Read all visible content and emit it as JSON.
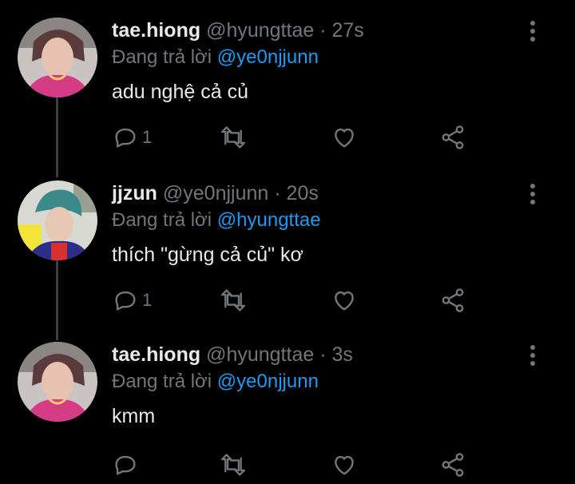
{
  "tweets": [
    {
      "name": "tae.hiong",
      "handle": "@hyungttae",
      "dot": "·",
      "time": "27s",
      "reply_prefix": "Đang trả lời",
      "reply_to": "@ye0njjunn",
      "text": "adu nghệ cả củ",
      "reply_count": "1"
    },
    {
      "name": "jjzun",
      "handle": "@ye0njjunn",
      "dot": "·",
      "time": "20s",
      "reply_prefix": "Đang trả lời",
      "reply_to": "@hyungttae",
      "text": "thích \"gừng cả củ\" kơ",
      "reply_count": "1"
    },
    {
      "name": "tae.hiong",
      "handle": "@hyungttae",
      "dot": "·",
      "time": "3s",
      "reply_prefix": "Đang trả lời",
      "reply_to": "@ye0njjunn",
      "text": "kmm",
      "reply_count": ""
    }
  ],
  "icons": {
    "reply": "reply-icon",
    "retweet": "retweet-icon",
    "like": "heart-icon",
    "share": "share-icon",
    "more": "more-vertical-icon"
  },
  "colors": {
    "background": "#000000",
    "name": "#e7e9ea",
    "secondary": "#71767b",
    "mention": "#1d9bf0",
    "thread_line": "#3a3d41"
  }
}
